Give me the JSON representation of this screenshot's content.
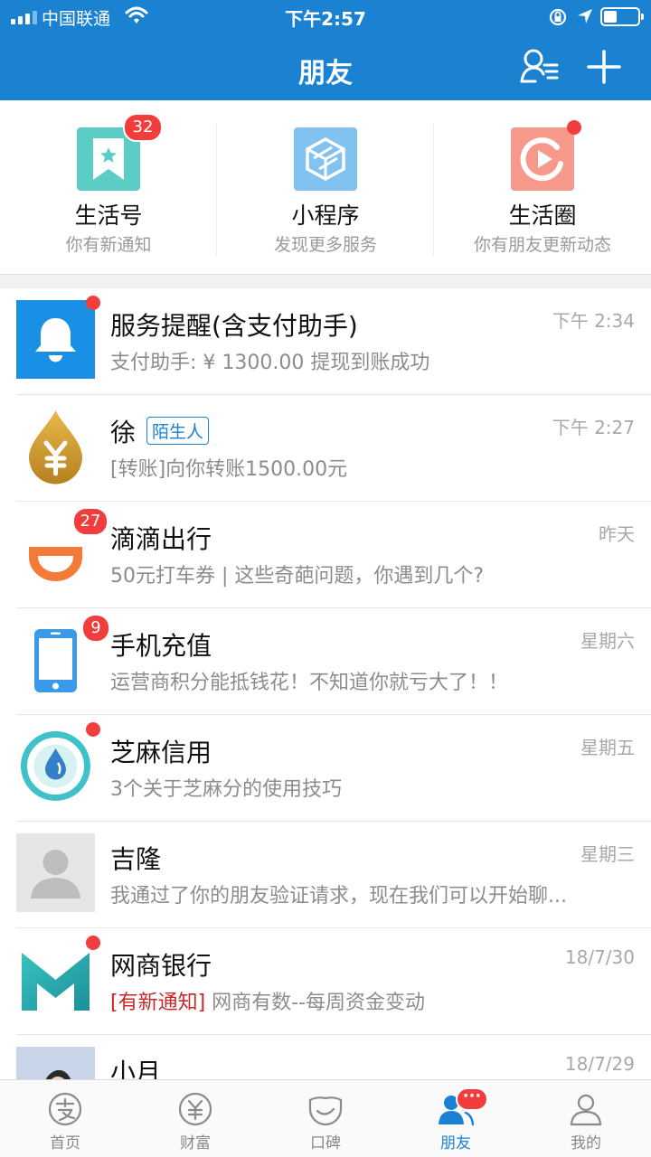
{
  "status_bar": {
    "carrier": "中国联通",
    "time": "下午2:57",
    "battery_level": 0.4
  },
  "header": {
    "title": "朋友"
  },
  "shortcuts": [
    {
      "name": "生活号",
      "desc": "你有新通知",
      "badge": "32",
      "icon": "bookmark-star-icon",
      "color": "#5ccdc4"
    },
    {
      "name": "小程序",
      "desc": "发现更多服务",
      "badge": "",
      "icon": "mini-program-icon",
      "color": "#82c2f0"
    },
    {
      "name": "生活圈",
      "desc": "你有朋友更新动态",
      "badge": "dot",
      "icon": "life-circle-icon",
      "color": "#f7998a"
    }
  ],
  "messages": [
    {
      "title": "服务提醒(含支付助手)",
      "time": "下午 2:34",
      "subtitle": "支付助手: ¥ 1300.00 提现到账成功",
      "badge": "dot",
      "icon": "bell-icon"
    },
    {
      "title": "徐",
      "tag": "陌生人",
      "time": "下午 2:27",
      "subtitle": "[转账]向你转账1500.00元",
      "badge": "",
      "icon": "yuan-drop-icon"
    },
    {
      "title": "滴滴出行",
      "time": "昨天",
      "subtitle": "50元打车券 | 这些奇葩问题，你遇到几个?",
      "badge": "27",
      "icon": "didi-icon"
    },
    {
      "title": "手机充值",
      "time": "星期六",
      "subtitle": "运营商积分能抵钱花！不知道你就亏大了！！",
      "badge": "9",
      "icon": "phone-icon"
    },
    {
      "title": "芝麻信用",
      "time": "星期五",
      "subtitle": "3个关于芝麻分的使用技巧",
      "badge": "dot",
      "icon": "sesame-credit-icon"
    },
    {
      "title": "吉隆",
      "time": "星期三",
      "subtitle": "我通过了你的朋友验证请求，现在我们可以开始聊...",
      "badge": "",
      "icon": "default-avatar-icon"
    },
    {
      "title": "网商银行",
      "time": "18/7/30",
      "subtitle_prefix": "[有新通知]",
      "subtitle": " 网商有数--每周资金变动",
      "badge": "dot",
      "icon": "mybank-icon"
    },
    {
      "title": "小月",
      "time": "18/7/29",
      "subtitle": "",
      "badge": "",
      "icon": "photo-avatar-icon"
    }
  ],
  "tabs": [
    {
      "label": "首页",
      "icon": "alipay-home-icon",
      "active": false
    },
    {
      "label": "财富",
      "icon": "wealth-icon",
      "active": false
    },
    {
      "label": "口碑",
      "icon": "koubei-icon",
      "active": false
    },
    {
      "label": "朋友",
      "icon": "friends-icon",
      "active": true,
      "badge": "···"
    },
    {
      "label": "我的",
      "icon": "profile-icon",
      "active": false
    }
  ]
}
